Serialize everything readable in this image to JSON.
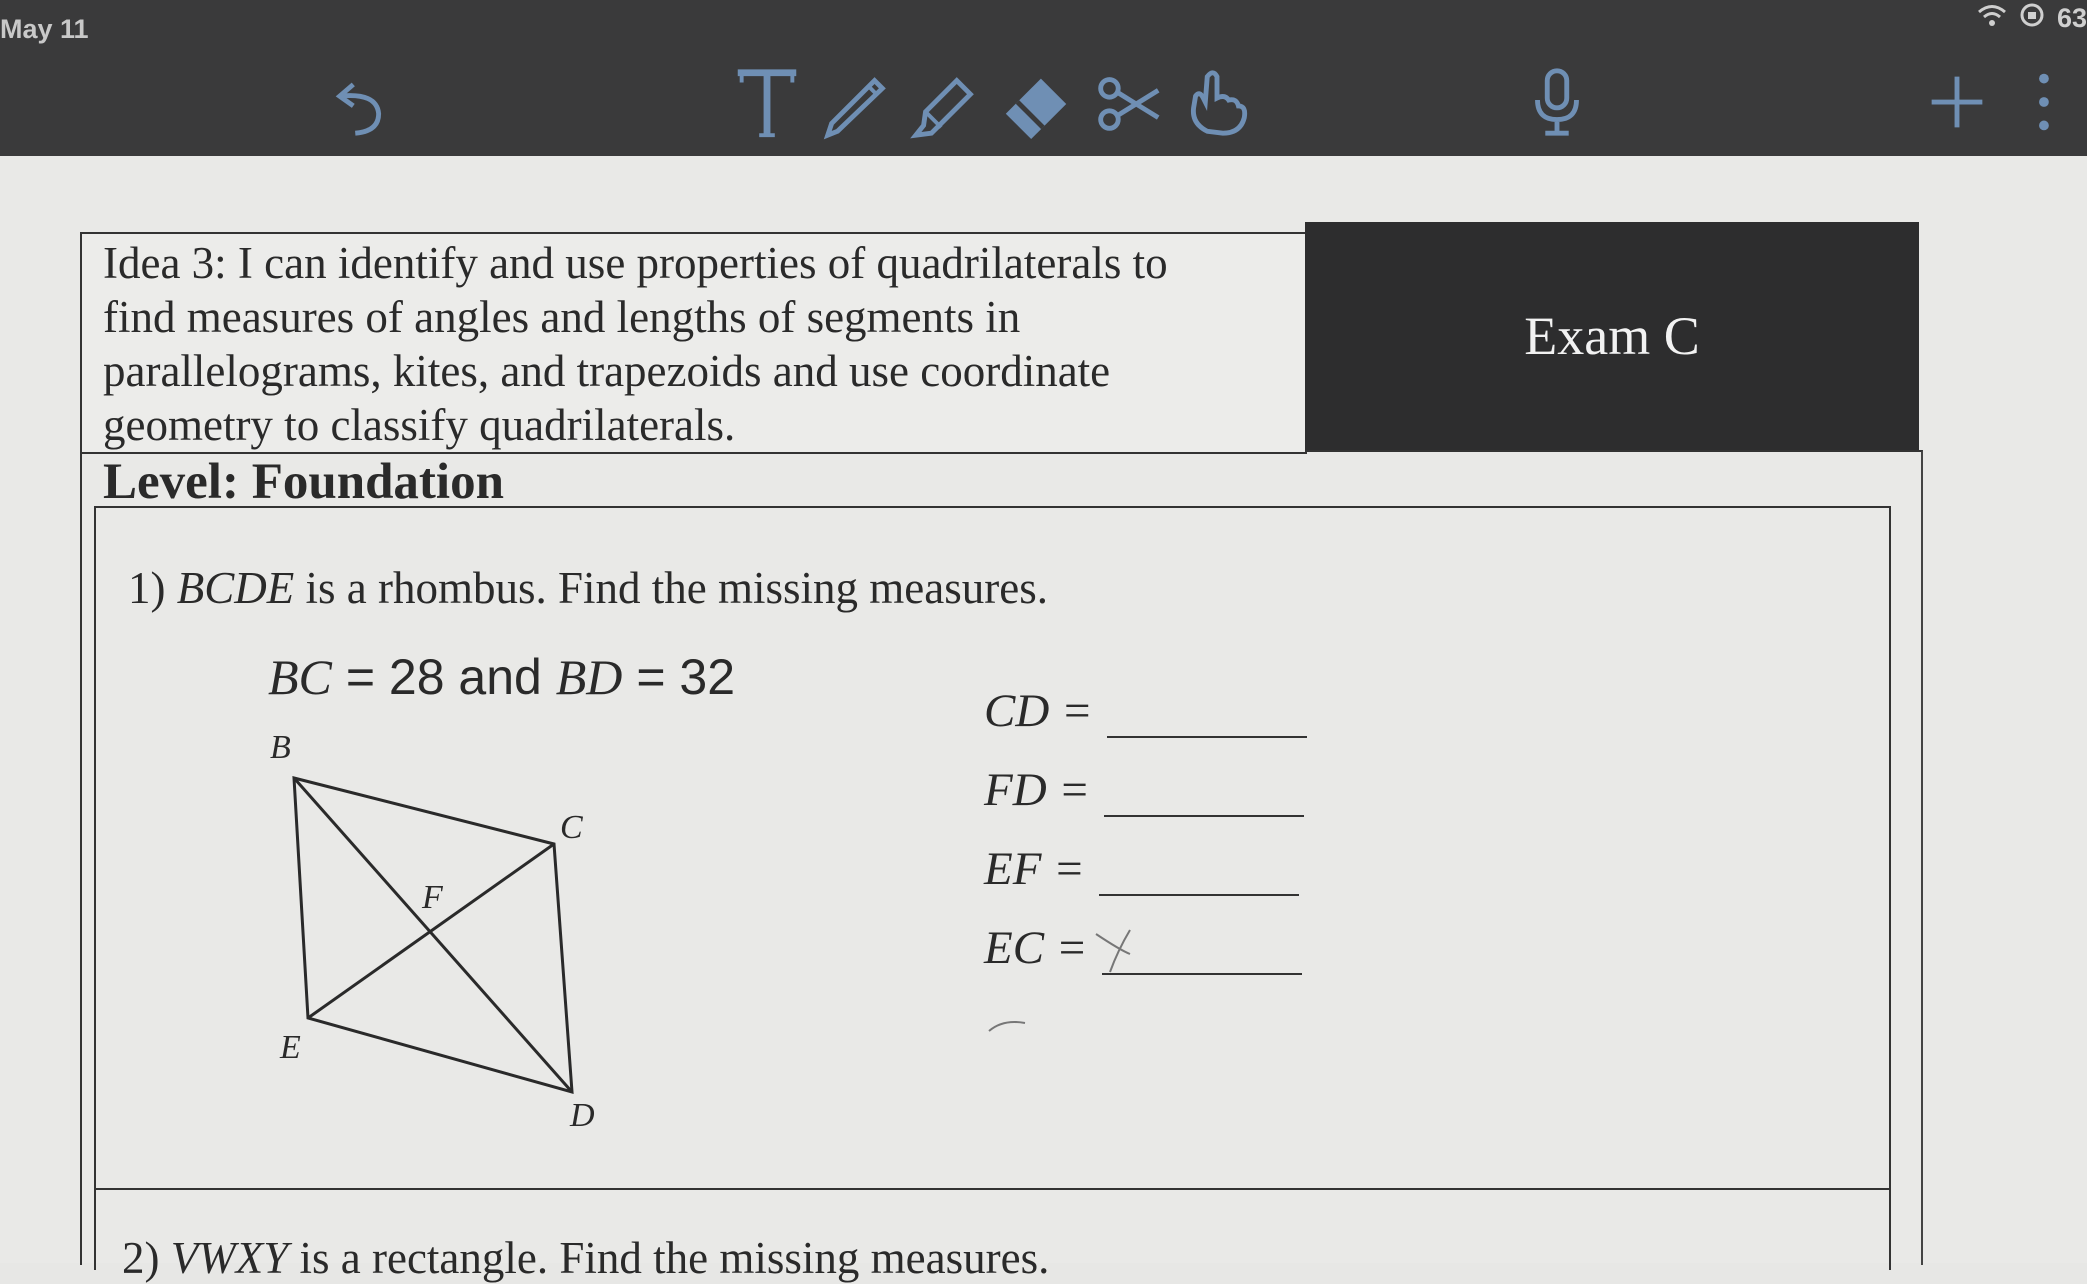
{
  "status_bar": {
    "date": "May 11",
    "battery": "63"
  },
  "toolbar": {
    "tools": [
      {
        "name": "undo-icon"
      },
      {
        "name": "text-tool-icon"
      },
      {
        "name": "pen-icon"
      },
      {
        "name": "highlighter-icon"
      },
      {
        "name": "eraser-icon"
      },
      {
        "name": "scissors-icon"
      },
      {
        "name": "hand-touch-icon"
      },
      {
        "name": "microphone-icon"
      },
      {
        "name": "plus-icon"
      },
      {
        "name": "more-icon"
      }
    ]
  },
  "worksheet": {
    "idea_lines": [
      "Idea 3: I can identify and use properties of quadrilaterals to",
      "find measures of angles and lengths of segments in",
      "parallelograms, kites, and trapezoids and use coordinate",
      "geometry to classify quadrilaterals."
    ],
    "exam_label": "Exam C",
    "level_label": "Level: Foundation",
    "q1": {
      "number": "1)",
      "subject": "BCDE",
      "prompt": "is a rhombus.  Find the missing measures.",
      "given_bc_label": "BC",
      "given_bc_value": "= 28 and",
      "given_bd_label": "BD",
      "given_bd_value": "= 32",
      "answers": [
        {
          "label": "CD ="
        },
        {
          "label": "FD ="
        },
        {
          "label": "EF ="
        },
        {
          "label": "EC ="
        }
      ],
      "vertex_labels": {
        "B": "B",
        "C": "C",
        "D": "D",
        "E": "E",
        "F": "F"
      }
    },
    "q2": {
      "number": "2)",
      "subject": "VWXY",
      "prompt": "is a rectangle.  Find the missing measures."
    }
  },
  "colors": {
    "toolbar_bg": "#3a3a3b",
    "tool_blue": "#6f8fb4",
    "paper": "#e9e9e7",
    "ink": "#2a2a2a",
    "exam_box": "#2d2d2e"
  }
}
